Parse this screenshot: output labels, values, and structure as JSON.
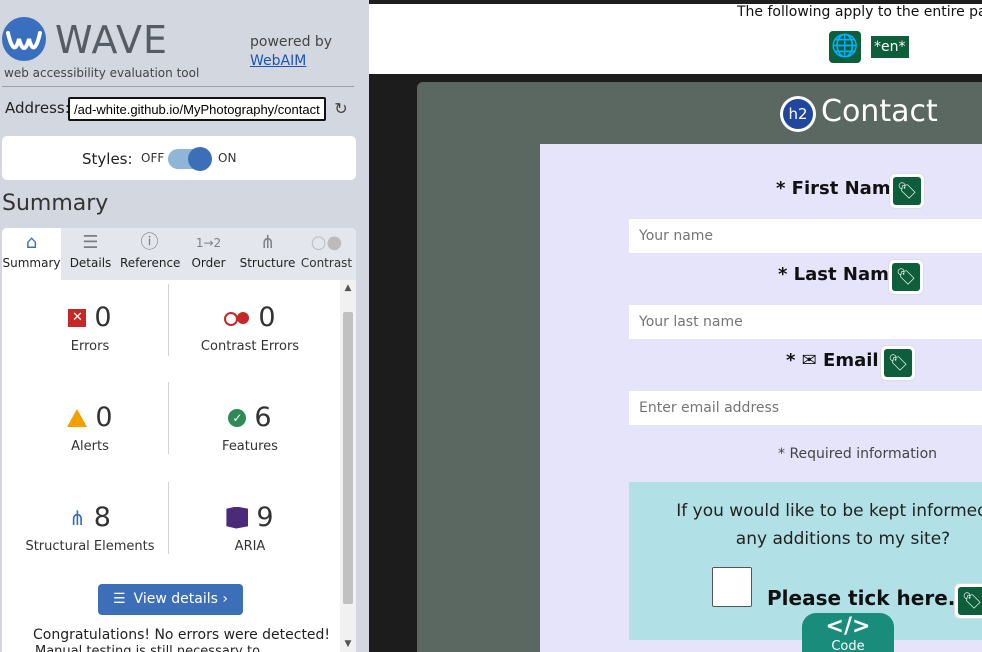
{
  "wave": {
    "logo_text": "WAVE",
    "tagline": "web accessibility evaluation tool",
    "powered_by": "powered by",
    "powered_by_link": "WebAIM",
    "address_label": "Address:",
    "address_value": "/ad-white.github.io/MyPhotography/contact",
    "styles_label": "Styles:",
    "styles_off": "OFF",
    "styles_on": "ON",
    "summary_heading": "Summary",
    "tabs": [
      {
        "label": "Summary",
        "icon": "home-icon"
      },
      {
        "label": "Details",
        "icon": "list-icon"
      },
      {
        "label": "Reference",
        "icon": "info-icon"
      },
      {
        "label": "Order",
        "icon": "order-icon"
      },
      {
        "label": "Structure",
        "icon": "structure-icon"
      },
      {
        "label": "Contrast",
        "icon": "contrast-icon"
      }
    ],
    "cards": {
      "errors": {
        "value": "0",
        "label": "Errors"
      },
      "contrast": {
        "value": "0",
        "label": "Contrast Errors"
      },
      "alerts": {
        "value": "0",
        "label": "Alerts"
      },
      "features": {
        "value": "6",
        "label": "Features"
      },
      "structural": {
        "value": "8",
        "label": "Structural Elements"
      },
      "aria": {
        "value": "9",
        "label": "ARIA"
      }
    },
    "view_details": "View details ›",
    "congrats": "Congratulations! No errors were detected!",
    "manual": "Manual testing is still necessary to"
  },
  "page": {
    "notice": "The following apply to the entire page",
    "lang_badge": "*en*",
    "heading_badge": "h2",
    "title": "Contact",
    "fields": {
      "first_name_label": "* First Name:",
      "first_name_placeholder": "Your name",
      "last_name_label": "* Last Name:",
      "last_name_placeholder": "Your last name",
      "email_label": "* ✉ Email:",
      "email_placeholder": "Enter email address"
    },
    "required_note": "* Required information",
    "newsletter_question": "If you would like to be kept informed of any additions to my site?",
    "tick_label": "Please tick here... ✓",
    "code_label": "Code"
  },
  "colors": {
    "wave_blue": "#3d6fb8",
    "tag_green": "#0e5e3b",
    "form_bg": "#e6e4fa",
    "newsletter_bg": "#b1e1e6",
    "card_bg": "#5a6861"
  }
}
